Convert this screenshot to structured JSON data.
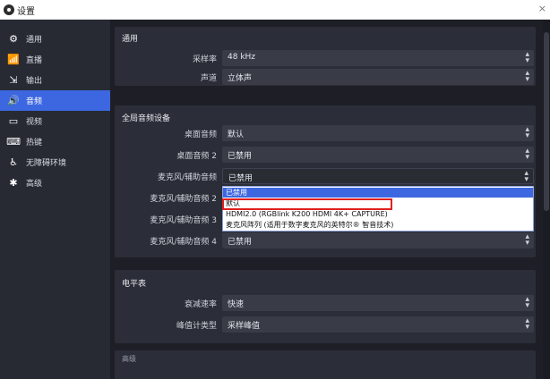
{
  "window": {
    "title": "设置",
    "close": "×"
  },
  "sidebar": {
    "items": [
      {
        "label": "通用",
        "icon": "gear-icon",
        "glyph": "⚙"
      },
      {
        "label": "直播",
        "icon": "broadcast-icon",
        "glyph": "📶"
      },
      {
        "label": "输出",
        "icon": "output-icon",
        "glyph": "⇲"
      },
      {
        "label": "音频",
        "icon": "audio-icon",
        "glyph": "🔊",
        "active": true
      },
      {
        "label": "视频",
        "icon": "monitor-icon",
        "glyph": "▭"
      },
      {
        "label": "热键",
        "icon": "keyboard-icon",
        "glyph": "⌨"
      },
      {
        "label": "无障碍环境",
        "icon": "accessibility-icon",
        "glyph": "♿"
      },
      {
        "label": "高级",
        "icon": "advanced-icon",
        "glyph": "✱"
      }
    ]
  },
  "general": {
    "title": "通用",
    "sample_rate": {
      "label": "采样率",
      "value": "48 kHz"
    },
    "channels": {
      "label": "声道",
      "value": "立体声"
    }
  },
  "global_audio": {
    "title": "全局音频设备",
    "desktop1": {
      "label": "桌面音频",
      "value": "默认"
    },
    "desktop2": {
      "label": "桌面音频 2",
      "value": "已禁用"
    },
    "mic1": {
      "label": "麦克风/辅助音频",
      "value": "已禁用"
    },
    "mic2": {
      "label": "麦克风/辅助音频 2"
    },
    "mic3": {
      "label": "麦克风/辅助音频 3"
    },
    "mic4": {
      "label": "麦克风/辅助音频 4",
      "value": "已禁用"
    }
  },
  "dropdown": {
    "options": [
      "已禁用",
      "默认",
      "HDMI2.0 (RGBlink K200 HDMI 4K+ CAPTURE)",
      "麦克风阵列 (适用于数字麦克风的英特尔® 智音技术)"
    ],
    "highlighted_index": 0,
    "boxed_index": 1
  },
  "meters": {
    "title": "电平表",
    "decay": {
      "label": "衰减速率",
      "value": "快速"
    },
    "peak": {
      "label": "峰值计类型",
      "value": "采样峰值"
    }
  },
  "next_group_title": "高级",
  "colors": {
    "accent": "#3d67e0",
    "panel": "#2b2e38",
    "background": "#1e1f26",
    "highlight_box": "#e02020"
  }
}
